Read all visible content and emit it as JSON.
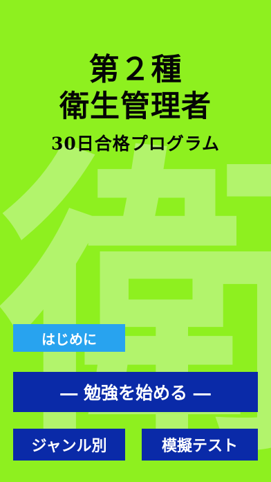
{
  "app": {
    "title_line1": "第２種",
    "title_line2": "衛生管理者",
    "subtitle": "30日合格プログラム",
    "watermark_glyph": "衛"
  },
  "buttons": {
    "intro_label": "はじめに",
    "start_label": "― 勉強を始める ―",
    "genre_label": "ジャンル別",
    "mock_test_label": "模擬テスト"
  },
  "colors": {
    "background": "#8ef01f",
    "watermark": "#b8f57a",
    "intro_button": "#28a3ef",
    "primary_button": "#0a2aa8",
    "title_text": "#050505",
    "button_text": "#ffffff"
  }
}
